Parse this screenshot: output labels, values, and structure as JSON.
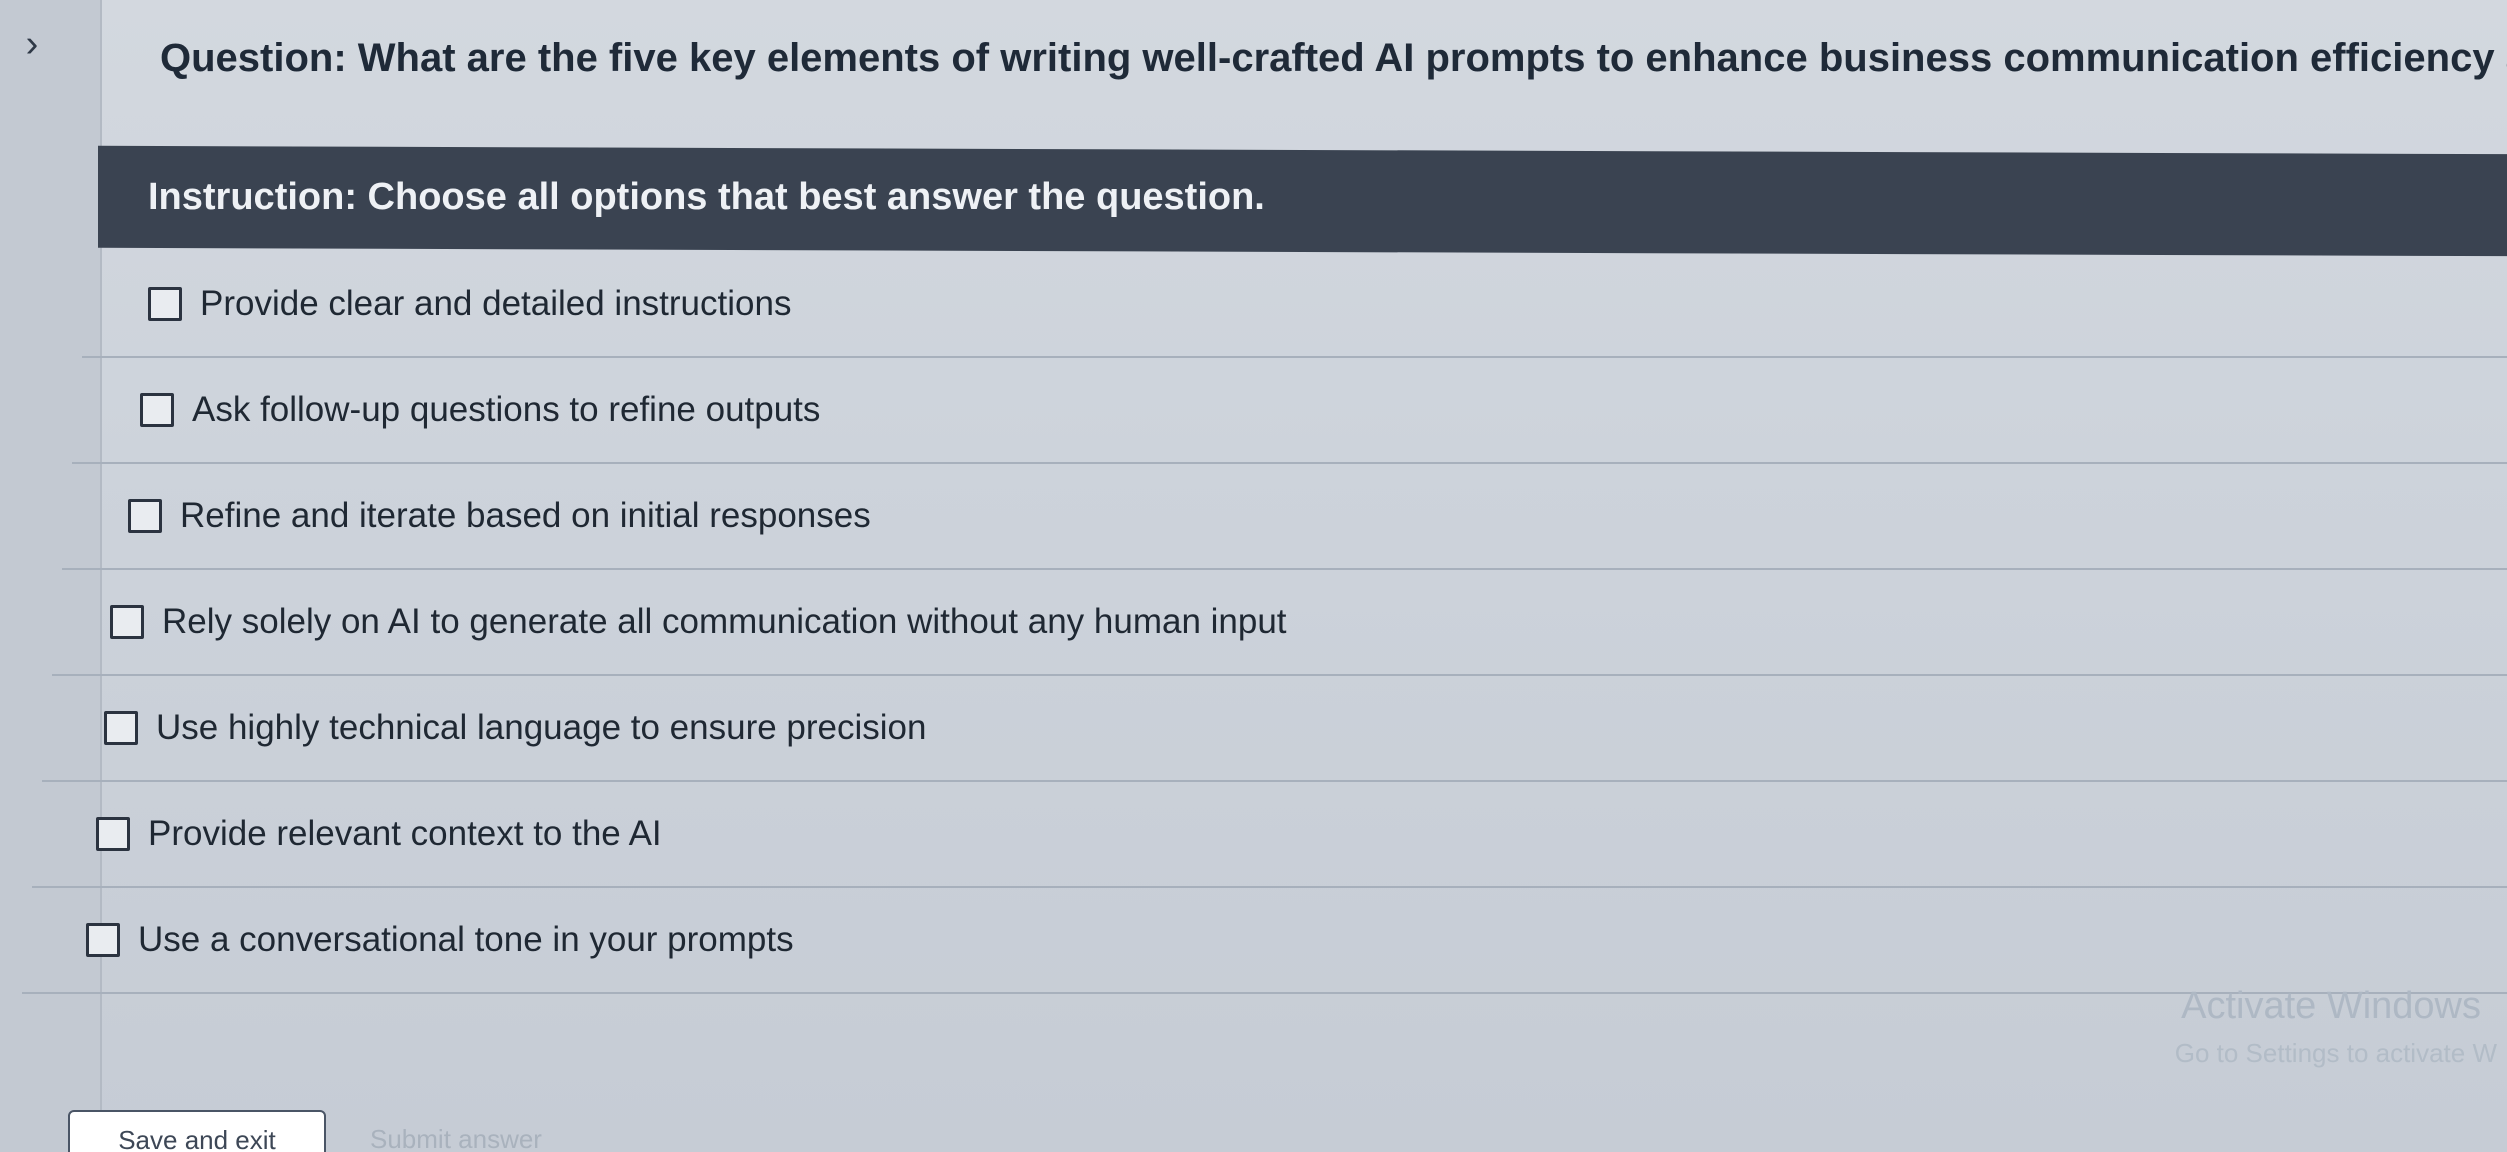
{
  "question": "Question: What are the five key elements of writing well-crafted AI prompts to enhance business communication efficiency and quality?",
  "instruction": "Instruction: Choose all options that best answer the question.",
  "options": [
    {
      "label": "Provide clear and detailed instructions"
    },
    {
      "label": "Ask follow-up questions to refine outputs"
    },
    {
      "label": "Refine and iterate based on initial responses"
    },
    {
      "label": "Rely solely on AI to generate all communication without any human input"
    },
    {
      "label": "Use highly technical language to ensure precision"
    },
    {
      "label": "Provide relevant context to the AI"
    },
    {
      "label": "Use a conversational tone in your prompts"
    }
  ],
  "watermark": {
    "title": "Activate Windows",
    "subtitle": "Go to Settings to activate W"
  },
  "buttons": {
    "save": "Save and exit",
    "submit": "Submit answer"
  },
  "icons": {
    "expand": "chevron-right-icon"
  }
}
